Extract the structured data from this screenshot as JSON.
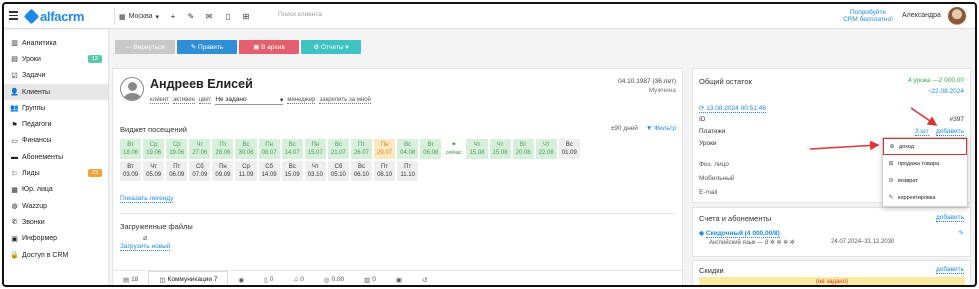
{
  "topbar": {
    "logo": "alfacrm",
    "branch": "Москва",
    "icons": [
      "add-icon",
      "wrench-icon",
      "mail-icon",
      "phone-icon",
      "cart-icon"
    ],
    "search_placeholder": "Поиск клиента",
    "promo_line1": "Попробуйте",
    "promo_line2": "CRM бесплатно!",
    "user_name": "Александра"
  },
  "sidebar": {
    "items": [
      {
        "label": "Аналитика",
        "icon": "chart-icon"
      },
      {
        "label": "Уроки",
        "icon": "lessons-icon",
        "badge": "12"
      },
      {
        "label": "Задачи",
        "icon": "tasks-icon"
      },
      {
        "label": "Клиенты",
        "icon": "user-icon"
      },
      {
        "label": "Группы",
        "icon": "group-icon"
      },
      {
        "label": "Педагоги",
        "icon": "teacher-icon"
      },
      {
        "label": "Финансы",
        "icon": "money-icon"
      },
      {
        "label": "Абонементы",
        "icon": "card-icon"
      },
      {
        "label": "Лиды",
        "icon": "leads-icon",
        "badge": "23"
      },
      {
        "label": "Юр. лица",
        "icon": "company-icon"
      },
      {
        "label": "Wazzup",
        "icon": "chat-icon"
      },
      {
        "label": "Звонки",
        "icon": "phone-icon"
      },
      {
        "label": "Информер",
        "icon": "informer-icon"
      },
      {
        "label": "Доступ в CRM",
        "icon": "lock-icon"
      }
    ],
    "active_item": "Клиенты",
    "badge_colors": {
      "lessons": "#5bc8b0",
      "leads": "#f0a23b"
    }
  },
  "actions": {
    "back": "← Вернуться",
    "edit": "✎ Править",
    "archive": "▣ В архив",
    "reports": "⚙ Отчеты ▾"
  },
  "client": {
    "name": "Андреев Елисей",
    "tags": [
      "клиент",
      "активен",
      "цвет"
    ],
    "status_select": "Не задано",
    "manager": "менеджер",
    "assign": "закрепить за мной",
    "dob": "04.10.1987 (36 лет)",
    "gender": "Мужчина"
  },
  "widget": {
    "title": "Виджет посещений",
    "period": "±90 дней",
    "filter": "▼ Фильтр",
    "row1": [
      {
        "d": "Вт",
        "date": "18.06",
        "s": "p"
      },
      {
        "d": "Ср",
        "date": "19.06",
        "s": "p"
      },
      {
        "d": "Ср",
        "date": "19.06",
        "s": "p"
      },
      {
        "d": "Чт",
        "date": "27.06",
        "s": "p"
      },
      {
        "d": "Пт",
        "date": "28.06",
        "s": "p"
      },
      {
        "d": "Вс",
        "date": "30.06",
        "s": "p"
      },
      {
        "d": "Пн",
        "date": "08.07",
        "s": "p"
      },
      {
        "d": "Вс",
        "date": "14.07",
        "s": "p"
      },
      {
        "d": "Пн",
        "date": "15.07",
        "s": "p"
      },
      {
        "d": "Вс",
        "date": "21.07",
        "s": "p"
      },
      {
        "d": "Пт",
        "date": "26.07",
        "s": "p"
      },
      {
        "d": "Пн",
        "date": "29.07",
        "s": "o"
      },
      {
        "d": "Вс",
        "date": "04.08",
        "s": "p"
      },
      {
        "d": "Вт",
        "date": "06.08",
        "s": "p"
      },
      {
        "d": "⚑",
        "date": "сейчас",
        "s": "now"
      },
      {
        "d": "Чт",
        "date": "15.08",
        "s": "p"
      },
      {
        "d": "Чт",
        "date": "15.08",
        "s": "p"
      },
      {
        "d": "Вт",
        "date": "20.08",
        "s": "p"
      },
      {
        "d": "Чт",
        "date": "22.08",
        "s": "p"
      },
      {
        "d": "Вс",
        "date": "01.09",
        "s": "g"
      }
    ],
    "row2": [
      {
        "d": "Вт",
        "date": "03.09"
      },
      {
        "d": "Чт",
        "date": "05.09"
      },
      {
        "d": "Пт",
        "date": "06.09"
      },
      {
        "d": "Сб",
        "date": "07.09"
      },
      {
        "d": "Пн",
        "date": "09.09"
      },
      {
        "d": "Ср",
        "date": "11.09"
      },
      {
        "d": "Сб",
        "date": "14.09"
      },
      {
        "d": "Вс",
        "date": "15.09"
      },
      {
        "d": "Чт",
        "date": "03.10"
      },
      {
        "d": "Сб",
        "date": "05.10"
      },
      {
        "d": "Вс",
        "date": "06.10"
      },
      {
        "d": "Пт",
        "date": "08.10"
      },
      {
        "d": "Пт",
        "date": "11.10"
      }
    ],
    "legend": "Показать легенду"
  },
  "files": {
    "title": "Загруженные файлы",
    "upload": "Загрузить новый"
  },
  "tabs": [
    {
      "icon": "list-icon",
      "label": "18"
    },
    {
      "icon": "chat-icon",
      "label": "Коммуникации 7",
      "active": true
    },
    {
      "icon": "whatsapp-icon",
      "label": ""
    },
    {
      "icon": "doc-icon",
      "label": "0"
    },
    {
      "icon": "music-icon",
      "label": "0"
    },
    {
      "icon": "coins-icon",
      "label": "0,00"
    },
    {
      "icon": "table-icon",
      "label": "0"
    },
    {
      "icon": "image-icon",
      "label": ""
    },
    {
      "icon": "history-icon",
      "label": ""
    }
  ],
  "balance": {
    "title": "Общий остаток",
    "lessons": "4 урока",
    "amount": "—2 000,00",
    "date": "~22.08.2024",
    "updated": "⟳ 13.08.2024 00:51:48",
    "id_label": "ID",
    "id_value": "#397",
    "payments_label": "Платежи",
    "payments_count": "3 шт",
    "payments_add": "добавить",
    "lessons_label": "Уроки",
    "phys": "Физ. лицо",
    "mobile": "Мобильный",
    "email": "E-mail"
  },
  "payment_menu": {
    "items": [
      {
        "icon": "plus-circle-icon",
        "label": "доход"
      },
      {
        "icon": "cart-icon",
        "label": "продажа товара"
      },
      {
        "icon": "minus-circle-icon",
        "label": "возврат"
      },
      {
        "icon": "pencil-icon",
        "label": "корректировка"
      }
    ]
  },
  "subscriptions": {
    "title": "Счета и абонементы",
    "add": "добавить",
    "item_name": "Скидочный (4 000,00/8)",
    "item_desc": "Английский язык — 8 ✲ ✲ ✲ ✲",
    "item_dates": "24.07.2024–31.12.2030"
  },
  "discounts": {
    "title": "Скидки",
    "add": "добавить",
    "empty": "(не задано)"
  },
  "colors": {
    "accent": "#1e88e5",
    "present": "#d6efd8",
    "future": "#eeeeee",
    "missed": "#fbe7c2",
    "green": "#3aa64c",
    "red": "#d33"
  }
}
